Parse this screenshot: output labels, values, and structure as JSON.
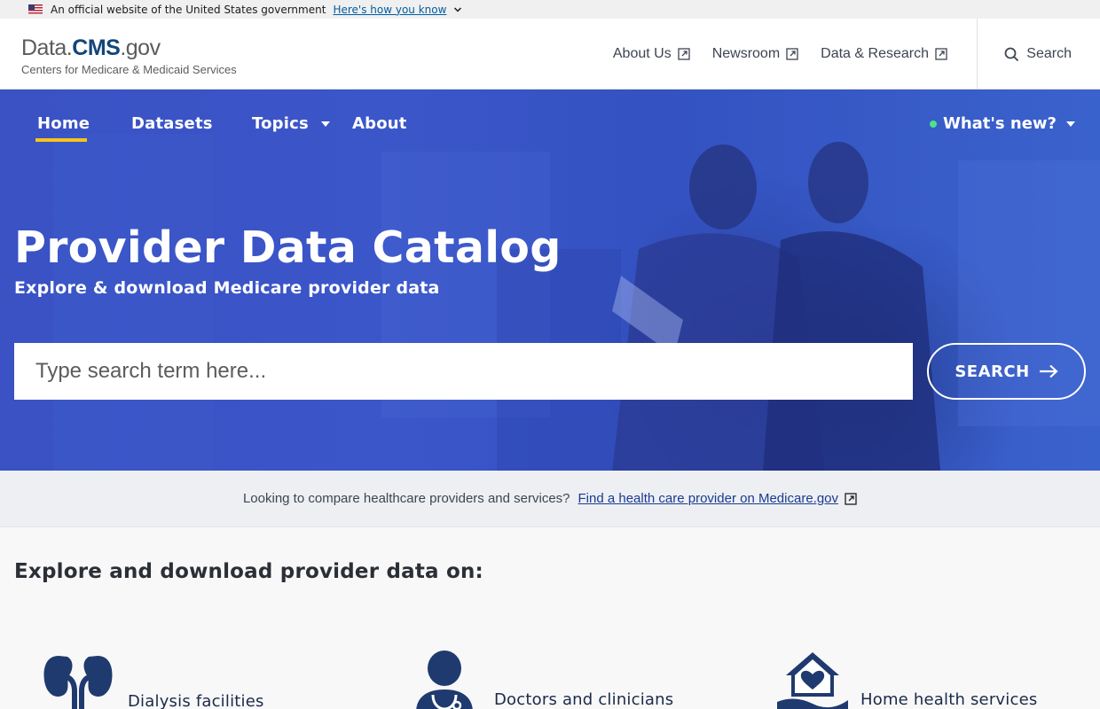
{
  "gov_banner": {
    "text": "An official website of the United States government",
    "link": "Here's how you know"
  },
  "header": {
    "logo_prefix": "Data.",
    "logo_brand": "CMS",
    "logo_suffix": ".gov",
    "logo_sub": "Centers for Medicare & Medicaid Services",
    "links": [
      "About Us",
      "Newsroom",
      "Data & Research"
    ],
    "search_label": "Search"
  },
  "nav": {
    "home": "Home",
    "datasets": "Datasets",
    "topics": "Topics",
    "about": "About",
    "whats_new": "What's new?"
  },
  "hero": {
    "title": "Provider Data Catalog",
    "subtitle": "Explore & download Medicare provider data",
    "search_placeholder": "Type search term here...",
    "search_button": "SEARCH"
  },
  "compare": {
    "text": "Looking to compare healthcare providers and services?",
    "link": "Find a health care provider on Medicare.gov"
  },
  "explore": {
    "title": "Explore and download provider data on:",
    "categories": [
      "Dialysis facilities",
      "Doctors and clinicians",
      "Home health services"
    ]
  },
  "colors": {
    "brand_navy": "#13467a",
    "hero_blue": "#3a52c4",
    "accent_yellow": "#f5c518",
    "icon_navy": "#1f3a6e",
    "new_dot_green": "#4ee38a"
  }
}
